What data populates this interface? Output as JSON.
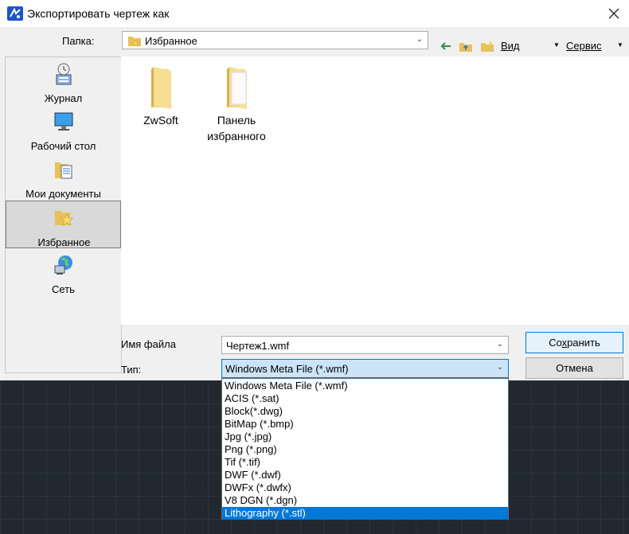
{
  "window": {
    "title": "Экспортировать чертеж как"
  },
  "toolbar": {
    "folder_label": "Папка:",
    "folder_value": "Избранное",
    "view_label": "Вид",
    "service_label": "Сервис"
  },
  "places": [
    {
      "label": "Журнал",
      "icon": "history-icon"
    },
    {
      "label": "Рабочий стол",
      "icon": "desktop-icon"
    },
    {
      "label": "Мои документы",
      "icon": "documents-icon"
    },
    {
      "label": "Избранное",
      "icon": "favorites-icon",
      "selected": true
    },
    {
      "label": "Сеть",
      "icon": "network-icon"
    }
  ],
  "files": [
    {
      "name": "ZwSoft",
      "icon": "folder-icon"
    },
    {
      "name": "Панель избранного",
      "icon": "folder-icon"
    }
  ],
  "bottom": {
    "filename_label": "Имя файла",
    "filename_value": "Чертеж1.wmf",
    "type_label": "Тип:",
    "type_value": "Windows Meta File (*.wmf)",
    "save_label_pre": "Со",
    "save_label_u": "х",
    "save_label_post": "ранить",
    "cancel_label": "Отмена"
  },
  "type_options": [
    "Windows Meta File (*.wmf)",
    "ACIS (*.sat)",
    "Block(*.dwg)",
    "BitMap (*.bmp)",
    "Jpg (*.jpg)",
    "Png (*.png)",
    "Tif (*.tif)",
    "DWF (*.dwf)",
    "DWFx (*.dwfx)",
    "V8 DGN (*.dgn)",
    "Lithography (*.stl)"
  ],
  "type_selected_index": 10,
  "colors": {
    "accent": "#0078d7",
    "canvas": "#212830"
  }
}
